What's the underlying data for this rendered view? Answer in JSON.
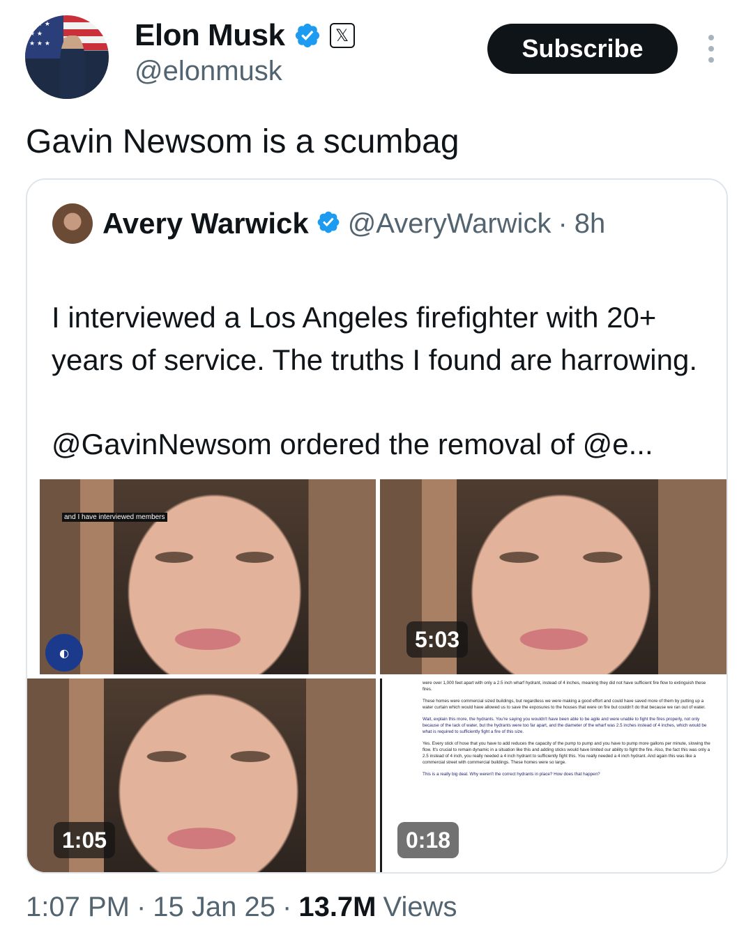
{
  "tweet": {
    "author": {
      "name": "Elon Musk",
      "handle": "@elonmusk",
      "verified_icon": "verified-badge-icon",
      "affiliation_icon": "x-logo-icon"
    },
    "subscribe_label": "Subscribe",
    "more_icon": "more-vertical-icon",
    "text": "Gavin Newsom is a scumbag",
    "timestamp": "1:07 PM",
    "date": "15 Jan 25",
    "views_count": "13.7M",
    "views_label": "Views",
    "separator": "·"
  },
  "quoted": {
    "name": "Avery Warwick",
    "handle": "@AveryWarwick",
    "time": "8h",
    "text_p1": "I interviewed a Los Angeles firefighter with 20+ years of service. The truths I found are harrowing.",
    "text_p2": "@GavinNewsom ordered the removal of @e...",
    "media": [
      {
        "kind": "video",
        "overlay_caption": "and I have interviewed members",
        "duration": ""
      },
      {
        "kind": "video",
        "duration": "5:03"
      },
      {
        "kind": "video",
        "duration": "1:05"
      },
      {
        "kind": "video",
        "duration": "0:18",
        "doc_lines": [
          "were over 1,000 feet apart with only a 2.5 inch wharf hydrant, instead of 4 inches, meaning they did not have sufficient fire flow to extinguish these fires.",
          "These homes were commercial sized buildings, but regardless we were making a good effort and could have saved more of them by putting up a water curtain which would have allowed us to save the exposures to the houses that were on fire but couldn't do that because we ran out of water.",
          "Wait, explain this more, the hydrants. You're saying you wouldn't have been able to be agile and were unable to fight the fires properly, not only because of the lack of water, but the hydrants were too far apart, and the diameter of the wharf was 2.5 inches instead of 4 inches, which would be what is required to sufficiently fight a fire of this size.",
          "Yes. Every stick of hose that you have to add reduces the capacity of the pump to pump and you have to pump more gallons per minute, slowing the flow. It's crucial to remain dynamic in a situation like this and adding sticks would have limited our ability to fight the fire. Also, the fact this was only a 2.5 instead of 4 inch, you really needed a 4 inch hydrant to sufficiently fight this. You really needed a 4 inch hydrant. And again this was like a commercial street with commercial buildings. These homes were so large.",
          "This is a really big deal. Why weren't the correct hydrants in place? How does that happen?"
        ]
      }
    ]
  },
  "colors": {
    "text": "#0f1419",
    "secondary": "#536471",
    "verified_blue": "#1d9bf0",
    "border": "#dfe5ea"
  }
}
